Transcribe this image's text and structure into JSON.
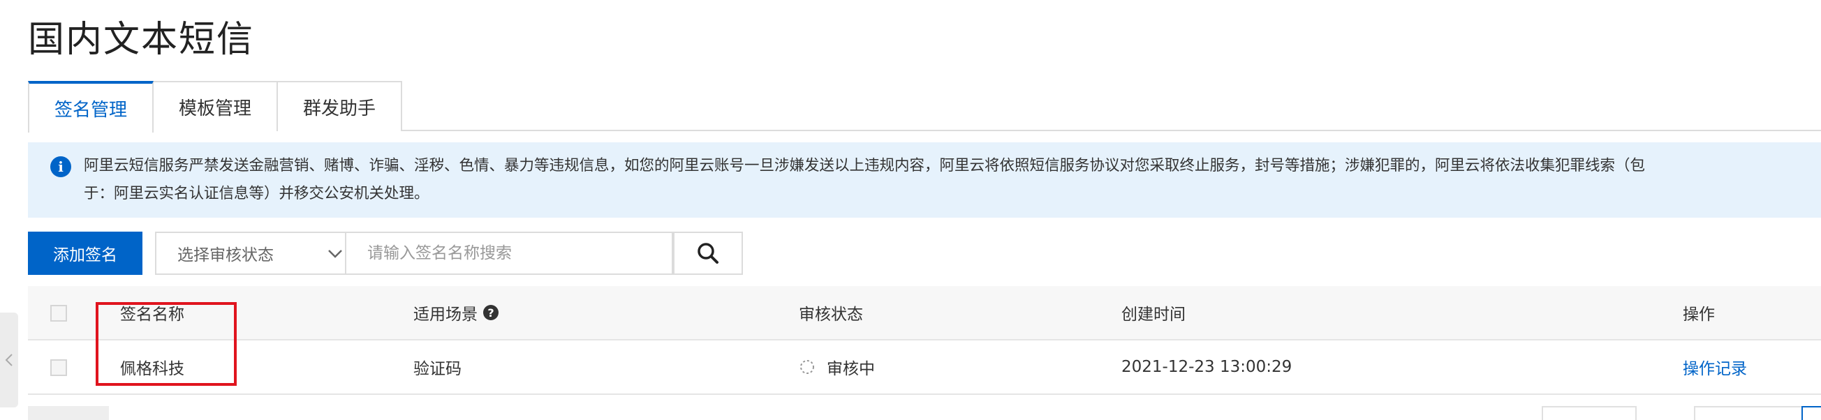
{
  "page": {
    "title": "国内文本短信"
  },
  "tabs": [
    {
      "label": "签名管理",
      "active": true
    },
    {
      "label": "模板管理",
      "active": false
    },
    {
      "label": "群发助手",
      "active": false
    }
  ],
  "notice": {
    "icon": "info-circle-icon",
    "text": "阿里云短信服务严禁发送金融营销、赌博、诈骗、淫秽、色情、暴力等违规信息，如您的阿里云账号一旦涉嫌发送以上违规内容，阿里云将依照短信服务协议对您采取终止服务，封号等措施；涉嫌犯罪的，阿里云将依法收集犯罪线索（包\n于：阿里云实名认证信息等）并移交公安机关处理。"
  },
  "toolbar": {
    "add_label": "添加签名",
    "status_select": {
      "placeholder": "选择审核状态"
    },
    "search": {
      "placeholder": "请输入签名名称搜索"
    }
  },
  "table": {
    "headers": {
      "name": "签名名称",
      "scene": "适用场景",
      "status": "审核状态",
      "created": "创建时间",
      "ops": "操作"
    },
    "rows": [
      {
        "name": "佩格科技",
        "scene": "验证码",
        "status": "审核中",
        "created": "2021-12-23 13:00:29",
        "op": "操作记录"
      }
    ]
  },
  "colors": {
    "accent": "#0064c8",
    "notice_bg": "#e6f2fc",
    "highlight": "#e0141e"
  }
}
